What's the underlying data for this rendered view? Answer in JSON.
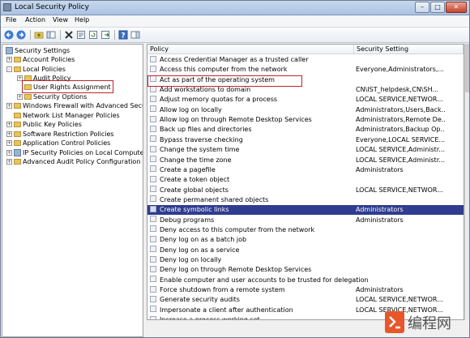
{
  "window": {
    "title": "Local Security Policy"
  },
  "menu": [
    "File",
    "Action",
    "View",
    "Help"
  ],
  "tree": [
    {
      "label": "Security Settings",
      "indent": 0,
      "toggle": "",
      "icon": "shield",
      "highlight": false
    },
    {
      "label": "Account Policies",
      "indent": 1,
      "toggle": "+",
      "icon": "folder",
      "highlight": false
    },
    {
      "label": "Local Policies",
      "indent": 1,
      "toggle": "-",
      "icon": "folder",
      "highlight": false
    },
    {
      "label": "Audit Policy",
      "indent": 2,
      "toggle": "+",
      "icon": "folder",
      "highlight": false
    },
    {
      "label": "User Rights Assignment",
      "indent": 2,
      "toggle": "",
      "icon": "folder",
      "highlight": true
    },
    {
      "label": "Security Options",
      "indent": 2,
      "toggle": "+",
      "icon": "folder",
      "highlight": false
    },
    {
      "label": "Windows Firewall with Advanced Security",
      "indent": 1,
      "toggle": "+",
      "icon": "folder",
      "highlight": false
    },
    {
      "label": "Network List Manager Policies",
      "indent": 1,
      "toggle": "",
      "icon": "folder",
      "highlight": false
    },
    {
      "label": "Public Key Policies",
      "indent": 1,
      "toggle": "+",
      "icon": "folder",
      "highlight": false
    },
    {
      "label": "Software Restriction Policies",
      "indent": 1,
      "toggle": "+",
      "icon": "folder",
      "highlight": false
    },
    {
      "label": "Application Control Policies",
      "indent": 1,
      "toggle": "+",
      "icon": "folder",
      "highlight": false
    },
    {
      "label": "IP Security Policies on Local Computer",
      "indent": 1,
      "toggle": "+",
      "icon": "shield",
      "highlight": false
    },
    {
      "label": "Advanced Audit Policy Configuration",
      "indent": 1,
      "toggle": "+",
      "icon": "folder",
      "highlight": false
    }
  ],
  "columns": {
    "policy": "Policy",
    "setting": "Security Setting"
  },
  "policies": [
    {
      "policy": "Access Credential Manager as a trusted caller",
      "setting": ""
    },
    {
      "policy": "Access this computer from the network",
      "setting": "Everyone,Administrators,..."
    },
    {
      "policy": "Act as part of the operating system",
      "setting": ""
    },
    {
      "policy": "Add workstations to domain",
      "setting": "CN\\IST_helpdesk,CN\\SH..."
    },
    {
      "policy": "Adjust memory quotas for a process",
      "setting": "LOCAL SERVICE,NETWOR..."
    },
    {
      "policy": "Allow log on locally",
      "setting": "Administrators,Users,Back..."
    },
    {
      "policy": "Allow log on through Remote Desktop Services",
      "setting": "Administrators,Remote De..."
    },
    {
      "policy": "Back up files and directories",
      "setting": "Administrators,Backup Op..."
    },
    {
      "policy": "Bypass traverse checking",
      "setting": "Everyone,LOCAL SERVICE..."
    },
    {
      "policy": "Change the system time",
      "setting": "LOCAL SERVICE,Administr..."
    },
    {
      "policy": "Change the time zone",
      "setting": "LOCAL SERVICE,Administr..."
    },
    {
      "policy": "Create a pagefile",
      "setting": "Administrators"
    },
    {
      "policy": "Create a token object",
      "setting": ""
    },
    {
      "policy": "Create global objects",
      "setting": "LOCAL SERVICE,NETWOR..."
    },
    {
      "policy": "Create permanent shared objects",
      "setting": ""
    },
    {
      "policy": "Create symbolic links",
      "setting": "Administrators"
    },
    {
      "policy": "Debug programs",
      "setting": "Administrators"
    },
    {
      "policy": "Deny access to this computer from the network",
      "setting": ""
    },
    {
      "policy": "Deny log on as a batch job",
      "setting": ""
    },
    {
      "policy": "Deny log on as a service",
      "setting": ""
    },
    {
      "policy": "Deny log on locally",
      "setting": ""
    },
    {
      "policy": "Deny log on through Remote Desktop Services",
      "setting": ""
    },
    {
      "policy": "Enable computer and user accounts to be trusted for delegation",
      "setting": ""
    },
    {
      "policy": "Force shutdown from a remote system",
      "setting": "Administrators"
    },
    {
      "policy": "Generate security audits",
      "setting": "LOCAL SERVICE,NETWOR..."
    },
    {
      "policy": "Impersonate a client after authentication",
      "setting": "LOCAL SERVICE,NETWOR..."
    },
    {
      "policy": "Increase a process working set",
      "setting": ""
    }
  ],
  "selected_policy": "Create symbolic links",
  "highlighted_policy": "Act as part of the operating system",
  "watermark": {
    "text": "编程网"
  },
  "colors": {
    "selection": "#2f3c8f",
    "highlight_box": "#c0242b",
    "title_bar": "#b9cde8"
  }
}
